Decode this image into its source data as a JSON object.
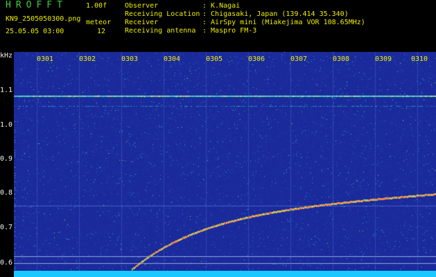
{
  "header": {
    "logo": "HROFFT",
    "version": "1.00f",
    "filename": "KN9_2505050300.png",
    "mode": "meteor",
    "datetime": "25.05.05 03:00",
    "count": "12",
    "fields": [
      {
        "label": "Observer",
        "value": ": K.Nagai"
      },
      {
        "label": "Receiving Location",
        "value": ": Chigasaki, Japan (139.414 35.340)"
      },
      {
        "label": "Receiver",
        "value": ": AirSpy mini (Miakejima VOR 108.65MHz)"
      },
      {
        "label": "Receiving antenna",
        "value": ": Maspro FM-3"
      }
    ]
  },
  "axis": {
    "y_unit": "kHz",
    "y_ticks": [
      "1.1",
      "1.0",
      "0.9",
      "0.8",
      "0.7",
      "0.6"
    ],
    "x_ticks": [
      "0301",
      "0302",
      "0303",
      "0304",
      "0305",
      "0306",
      "0307",
      "0308",
      "0309",
      "0310"
    ]
  },
  "colors": {
    "background": "#1a2a9a",
    "trace": "#ff5050",
    "bottom_bar": "#19c8ff"
  }
}
